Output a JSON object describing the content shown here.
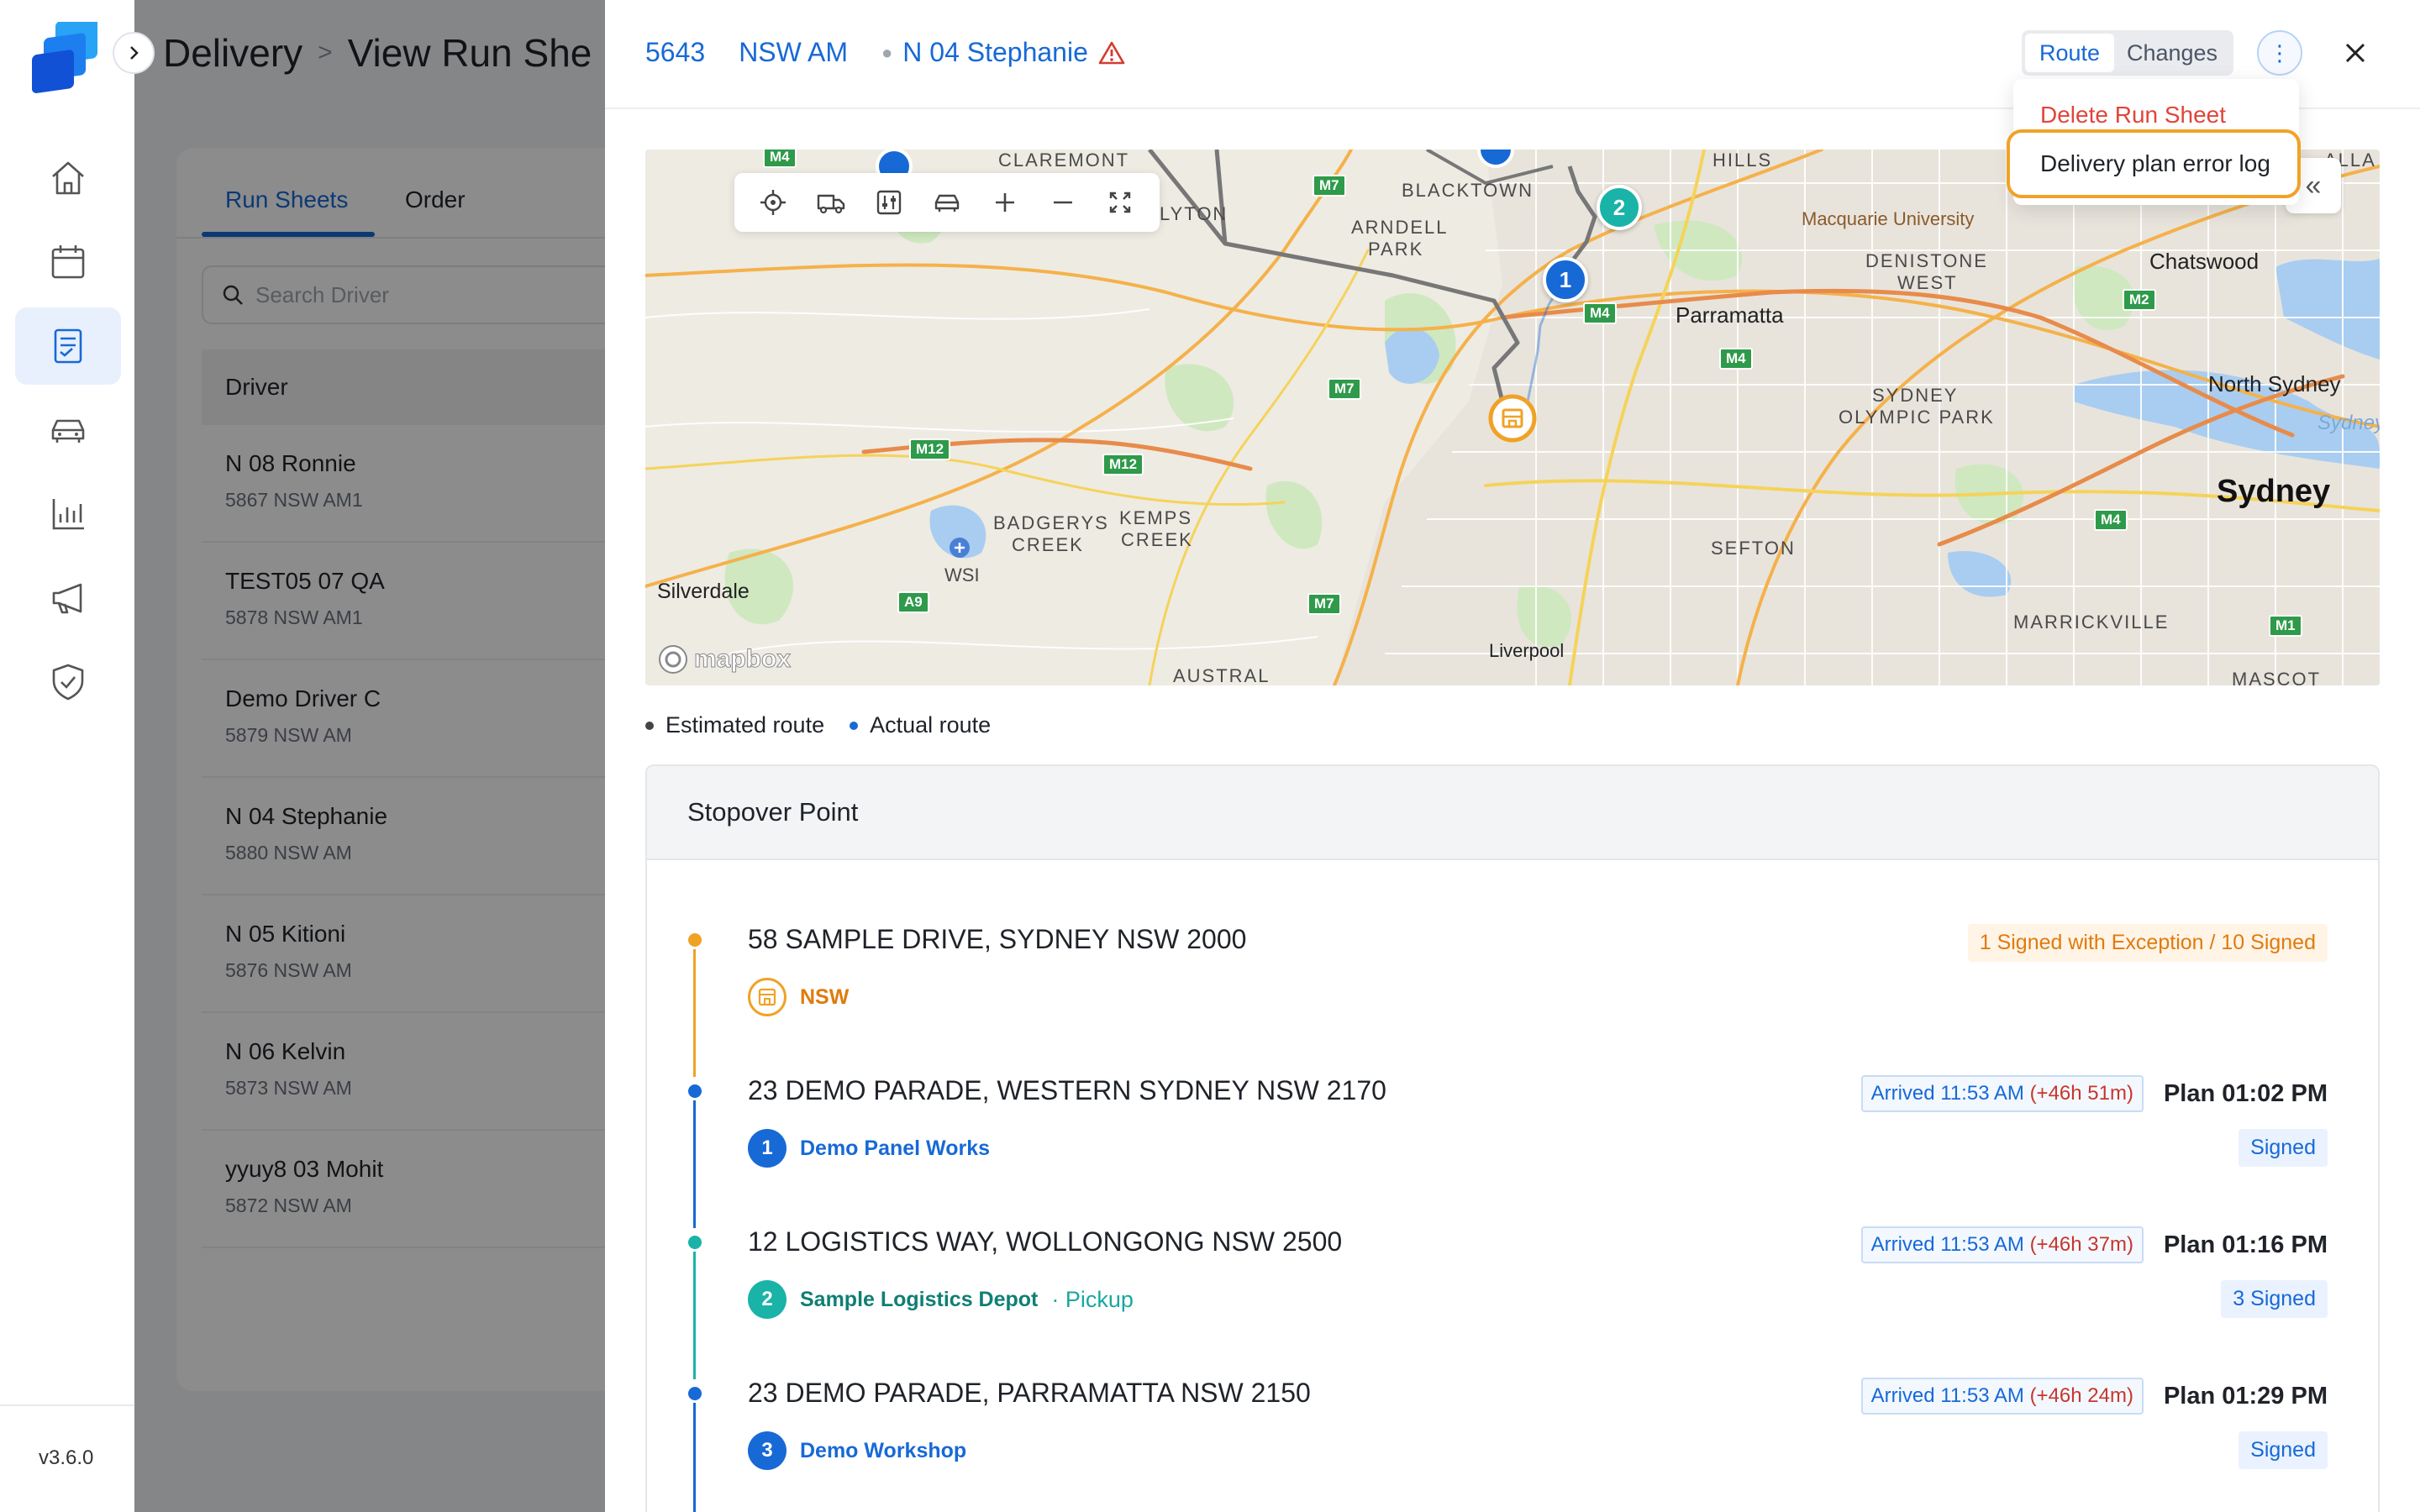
{
  "app": {
    "version": "v3.6.0",
    "breadcrumb": [
      "Delivery",
      "View Run She"
    ],
    "nav": [
      "home-icon",
      "calendar-icon",
      "runsheet-icon",
      "vehicle-icon",
      "chart-icon",
      "megaphone-icon",
      "shield-check-icon"
    ]
  },
  "background": {
    "tabs": [
      "Run Sheets",
      "Order"
    ],
    "search_placeholder": "Search Driver",
    "table_header": "Driver",
    "drivers": [
      {
        "name": "N 08 Ronnie",
        "sub": "5867 NSW AM1"
      },
      {
        "name": "TEST05 07 QA",
        "sub": "5878 NSW AM1"
      },
      {
        "name": "Demo Driver C",
        "sub": "5879 NSW AM"
      },
      {
        "name": "N 04 Stephanie",
        "sub": "5880 NSW AM"
      },
      {
        "name": "N 05 Kitioni",
        "sub": "5876 NSW AM"
      },
      {
        "name": "N 06 Kelvin",
        "sub": "5873 NSW AM"
      },
      {
        "name": "yyuy8 03 Mohit",
        "sub": "5872 NSW AM"
      }
    ]
  },
  "drawer": {
    "run_id": "5643",
    "region": "NSW AM",
    "driver": "N 04 Stephanie",
    "view_toggle": {
      "active": "Route",
      "other": "Changes"
    },
    "menu": {
      "delete": "Delete Run Sheet",
      "error_log": "Delivery plan error log"
    },
    "map": {
      "labels": {
        "claremont": "CLAREMONT",
        "hills": "HILLS",
        "blacktown": "BLACKTOWN",
        "arndell": "ARNDELL",
        "park": "PARK",
        "lyton": "LYTON",
        "macquarie": "Macquarie University",
        "denistone": "DENISTONE",
        "west": "WEST",
        "chatswood": "Chatswood",
        "parramatta": "Parramatta",
        "north_sydney": "North Sydney",
        "sydney_olympic": "SYDNEY",
        "olympic_park": "OLYMPIC PARK",
        "sydney_h": "Sydney H",
        "sydney": "Sydney",
        "badgerys": "BADGERYS",
        "creek": "CREEK",
        "kemps": "KEMPS",
        "kemps_creek": "CREEK",
        "wsi": "WSI",
        "sefton": "SEFTON",
        "silverdale": "Silverdale",
        "marrickville": "MARRICKVILLE",
        "liverpool": "Liverpool",
        "austral": "AUSTRAL",
        "mascot": "MASCOT",
        "alla": "ALLA"
      },
      "shields": {
        "m4a": "M4",
        "m7a": "M7",
        "m4b": "M4",
        "m4c": "M4",
        "m2": "M2",
        "m7b": "M7",
        "m12a": "M12",
        "m12b": "M12",
        "m4d": "M4",
        "a9": "A9",
        "m7c": "M7",
        "m1": "M1"
      },
      "markers": {
        "one": "1",
        "two": "2"
      },
      "attribution": "mapbox"
    },
    "legend": {
      "estimated": "Estimated route",
      "actual": "Actual route"
    },
    "stopover_title": "Stopover Point",
    "stops": [
      {
        "address": "58 SAMPLE DRIVE, SYDNEY NSW 2000",
        "label": "NSW",
        "status": "1 Signed with Exception / 10 Signed",
        "color": "#f0a227"
      },
      {
        "address": "23 DEMO PARADE, WESTERN SYDNEY NSW 2170",
        "num": "1",
        "label": "Demo Panel Works",
        "arrived": "Arrived 11:53 AM",
        "late": "(+46h 51m)",
        "plan": "Plan 01:02 PM",
        "status": "Signed",
        "color": "#1769d6"
      },
      {
        "address": "12 LOGISTICS WAY, WOLLONGONG NSW 2500",
        "num": "2",
        "label": "Sample Logistics Depot",
        "pickup": "· Pickup",
        "arrived": "Arrived 11:53 AM",
        "late": "(+46h 37m)",
        "plan": "Plan 01:16 PM",
        "status": "3 Signed",
        "color": "#19b3a8"
      },
      {
        "address": "23 DEMO PARADE, PARRAMATTA NSW 2150",
        "num": "3",
        "label": "Demo Workshop",
        "arrived": "Arrived 11:53 AM",
        "late": "(+46h 24m)",
        "plan": "Plan 01:29 PM",
        "status": "Signed",
        "color": "#1769d6"
      }
    ]
  }
}
